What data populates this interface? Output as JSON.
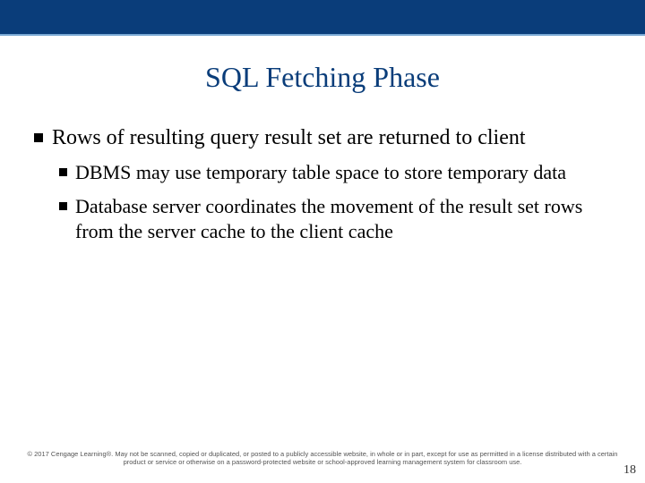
{
  "header": {
    "title": "SQL Fetching Phase"
  },
  "bullets": {
    "level1": [
      {
        "text": "Rows of resulting query result set are returned to client",
        "children": [
          {
            "text": "DBMS may use temporary table space to store temporary data"
          },
          {
            "text": "Database server coordinates the movement of the result set rows from the server cache to the client cache"
          }
        ]
      }
    ]
  },
  "footer": {
    "copyright": "© 2017 Cengage Learning®. May not be scanned, copied or duplicated, or posted to a publicly accessible website, in whole or in part, except for use as permitted in a license distributed with a certain product or service or otherwise on a password-protected website or school-approved learning management system for classroom use.",
    "page": "18"
  },
  "colors": {
    "brand_blue": "#0a3d7a",
    "accent_line": "#7aa9d4"
  }
}
